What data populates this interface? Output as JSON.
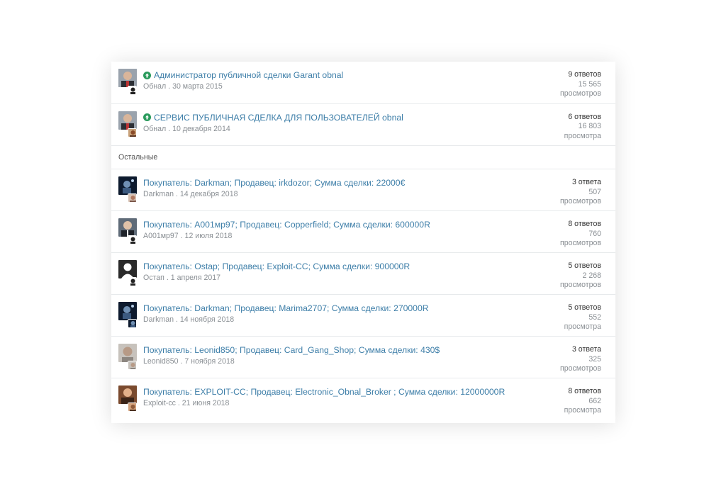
{
  "sticky_threads": [
    {
      "title": "Администратор публичной сделки Garant obnal",
      "author": "Обнал",
      "date": "30 марта 2015",
      "replies": "9 ответов",
      "views": "15 565",
      "views_label": "просмотров"
    },
    {
      "title": "СЕРВИС ПУБЛИЧНАЯ СДЕЛКА ДЛЯ ПОЛЬЗОВАТЕЛЕЙ obnal",
      "author": "Обнал",
      "date": "10 декабря 2014",
      "replies": "6 ответов",
      "views": "16 803",
      "views_label": "просмотра"
    }
  ],
  "separator_label": "Остальные",
  "threads": [
    {
      "title": "Покупатель: Darkman; Продавец: irkdozor; Сумма сделки: 22000€",
      "author": "Darkman",
      "date": "14 декабря 2018",
      "replies": "3 ответа",
      "views": "507",
      "views_label": "просмотров"
    },
    {
      "title": "Покупатель: A001мр97; Продавец: Copperfield; Сумма сделки: 600000R",
      "author": "A001мр97",
      "date": "12 июля 2018",
      "replies": "8 ответов",
      "views": "760",
      "views_label": "просмотров"
    },
    {
      "title": "Покупатель: Ostap; Продавец: Exploit-CC; Сумма сделки: 900000R",
      "author": "Остап",
      "date": "1 апреля 2017",
      "replies": "5 ответов",
      "views": "2 268",
      "views_label": "просмотров"
    },
    {
      "title": "Покупатель: Darkman; Продавец: Marima2707; Сумма сделки: 270000R",
      "author": "Darkman",
      "date": "14 ноября 2018",
      "replies": "5 ответов",
      "views": "552",
      "views_label": "просмотра"
    },
    {
      "title": "Покупатель: Leonid850; Продавец: Card_Gang_Shop; Сумма сделки: 430$",
      "author": "Leonid850",
      "date": "7 ноября 2018",
      "replies": "3 ответа",
      "views": "325",
      "views_label": "просмотров"
    },
    {
      "title": "Покупатель: EXPLOIT-CC; Продавец: Electronic_Obnal_Broker ; Сумма сделки: 12000000R",
      "author": "Exploit-cc",
      "date": "21 июня 2018",
      "replies": "8 ответов",
      "views": "662",
      "views_label": "просмотра"
    }
  ],
  "colors": {
    "link": "#3d7ea8",
    "sticky_icon": "#2a9a5c",
    "muted": "#8a8f94"
  },
  "icons": {
    "sticky": "pin-icon"
  }
}
